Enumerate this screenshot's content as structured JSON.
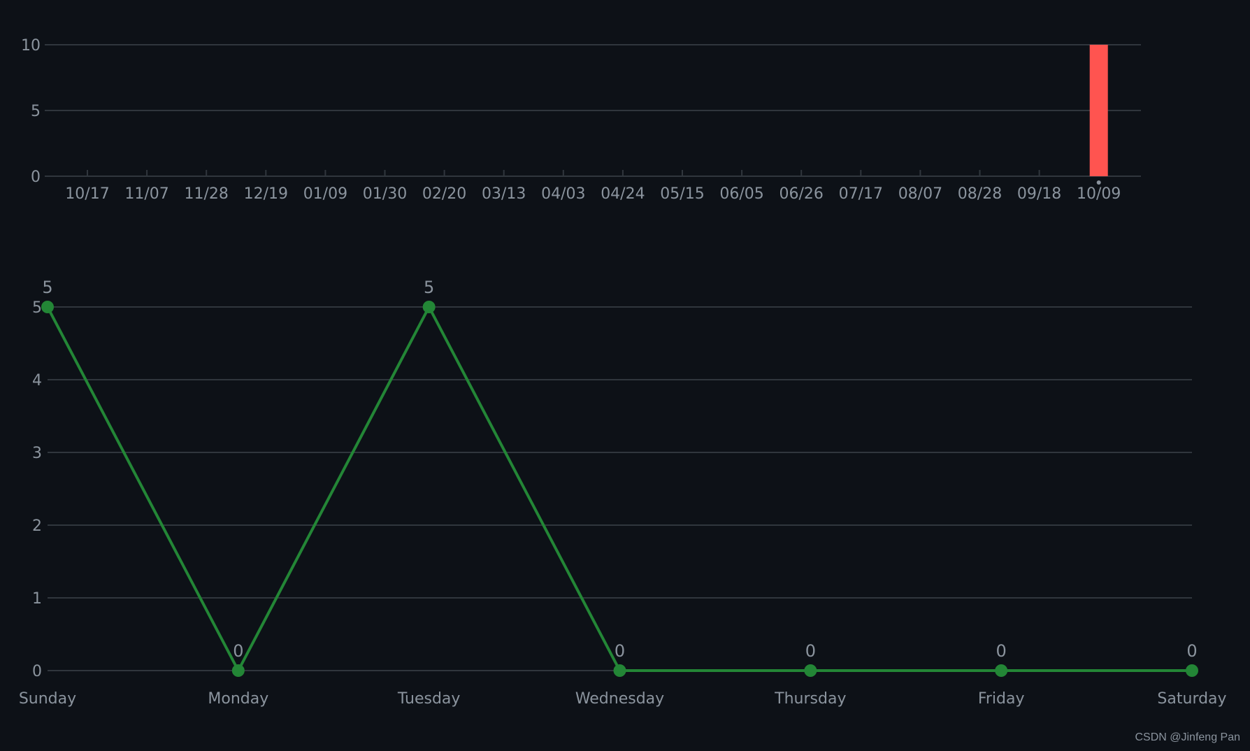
{
  "watermark": "CSDN @Jinfeng Pan",
  "colors": {
    "background": "#0d1117",
    "grid": "#30363d",
    "text": "#8b949e",
    "bar": "#ff5450",
    "line": "#238636"
  },
  "chart_data": [
    {
      "type": "bar",
      "title": "",
      "xlabel": "",
      "ylabel": "",
      "ylim": [
        0,
        10
      ],
      "yticks": [
        0,
        5,
        10
      ],
      "x_tick_labels": [
        "10/17",
        "11/07",
        "11/28",
        "12/19",
        "01/09",
        "01/30",
        "02/20",
        "03/13",
        "04/03",
        "04/24",
        "05/15",
        "06/05",
        "06/26",
        "07/17",
        "08/07",
        "08/28",
        "09/18",
        "10/09"
      ],
      "bars": [
        {
          "x": "10/09",
          "value": 10
        }
      ],
      "grid": true,
      "legend": "none"
    },
    {
      "type": "line",
      "title": "",
      "xlabel": "",
      "ylabel": "",
      "ylim": [
        0,
        5
      ],
      "yticks": [
        0,
        1,
        2,
        3,
        4,
        5
      ],
      "categories": [
        "Sunday",
        "Monday",
        "Tuesday",
        "Wednesday",
        "Thursday",
        "Friday",
        "Saturday"
      ],
      "values": [
        5,
        0,
        5,
        0,
        0,
        0,
        0
      ],
      "data_labels": true,
      "grid": true,
      "legend": "none"
    }
  ]
}
